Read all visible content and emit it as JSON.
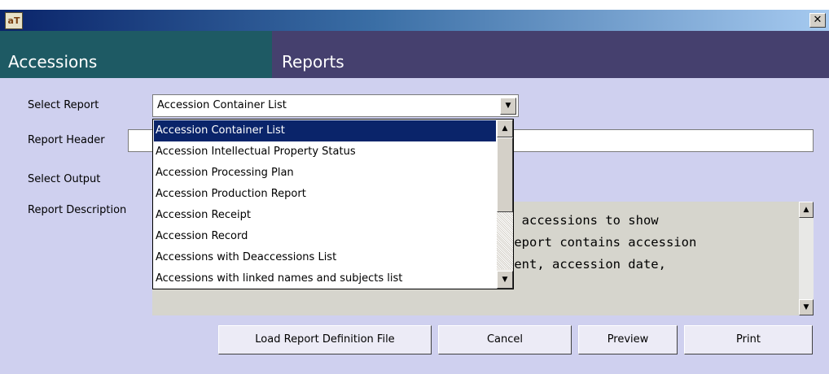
{
  "titlebar": {
    "app_icon": "aT",
    "close": "✕"
  },
  "header": {
    "left_title": "Accessions",
    "right_title": "Reports"
  },
  "form": {
    "select_report_label": "Select Report",
    "selected_report": "Accession Container List",
    "report_header_label": "Report Header",
    "report_header_value": "",
    "select_output_label": "Select Output",
    "report_description_label": "Report Description",
    "description_lines": [
      "f accessions to show",
      "Report contains accession",
      "tent, accession date,"
    ]
  },
  "dropdown": {
    "items": [
      "Accession Container List",
      "Accession Intellectual Property Status",
      "Accession Processing Plan",
      "Accession Production Report",
      "Accession Receipt",
      "Accession Record",
      "Accessions with Deaccessions List",
      "Accessions with linked names and subjects list"
    ]
  },
  "buttons": {
    "load": "Load Report Definition File",
    "cancel": "Cancel",
    "preview": "Preview",
    "print": "Print"
  }
}
